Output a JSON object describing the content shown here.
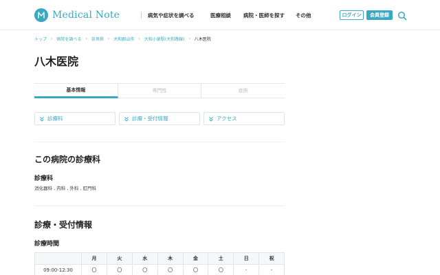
{
  "brand": {
    "name": "Medical Note",
    "color": "#3aa8c1"
  },
  "nav": [
    {
      "label": "病気や症状を調べる"
    },
    {
      "label": "医療相談"
    },
    {
      "label": "病院・医師を探す"
    },
    {
      "label": "その他"
    }
  ],
  "auth": {
    "login": "ログイン",
    "register": "会員登録"
  },
  "breadcrumb": [
    "トップ",
    "病院を調べる",
    "奈良県",
    "大和郡山市",
    "大和小泉駅(大和路線)",
    "八木医院"
  ],
  "page": {
    "title": "八木医院"
  },
  "tabs": [
    {
      "label": "基本情報",
      "active": true
    },
    {
      "label": "専門性",
      "active": false
    },
    {
      "label": "症例",
      "active": false
    }
  ],
  "section_links": [
    {
      "label": "診療科"
    },
    {
      "label": "診療・受付情報"
    },
    {
      "label": "アクセス"
    }
  ],
  "departments": {
    "heading": "この病院の診療科",
    "subheading": "診療科",
    "text": "消化器科 , 内科 , 外科 , 肛門科"
  },
  "reception": {
    "heading": "診療・受付情報",
    "subheading": "診療時間",
    "table": {
      "headers": [
        "",
        "月",
        "火",
        "水",
        "木",
        "金",
        "土",
        "日",
        "祝"
      ],
      "rows": [
        [
          "09:00-12:30",
          "〇",
          "〇",
          "〇",
          "〇",
          "〇",
          "〇",
          "-",
          "-"
        ]
      ]
    }
  }
}
